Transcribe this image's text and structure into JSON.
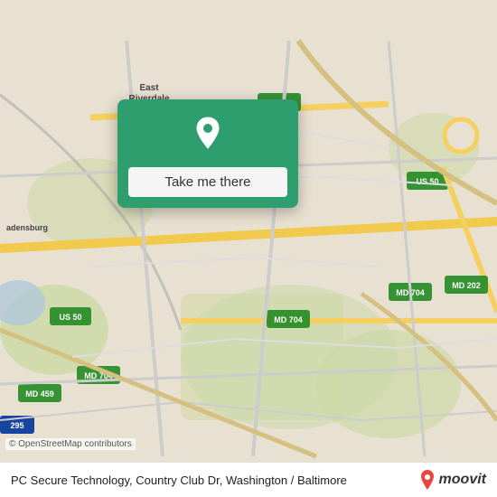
{
  "map": {
    "background_color": "#e8e0d8",
    "center_lat": 38.93,
    "center_lng": -76.91
  },
  "popup": {
    "background_color": "#2e9e6e",
    "button_label": "Take me there",
    "pin_icon": "location-pin"
  },
  "info_bar": {
    "location_text": "PC Secure Technology, Country Club Dr, Washington / Baltimore",
    "osm_credit": "© OpenStreetMap contributors",
    "logo_text": "moovit",
    "logo_pin_color": "#e8453c"
  }
}
